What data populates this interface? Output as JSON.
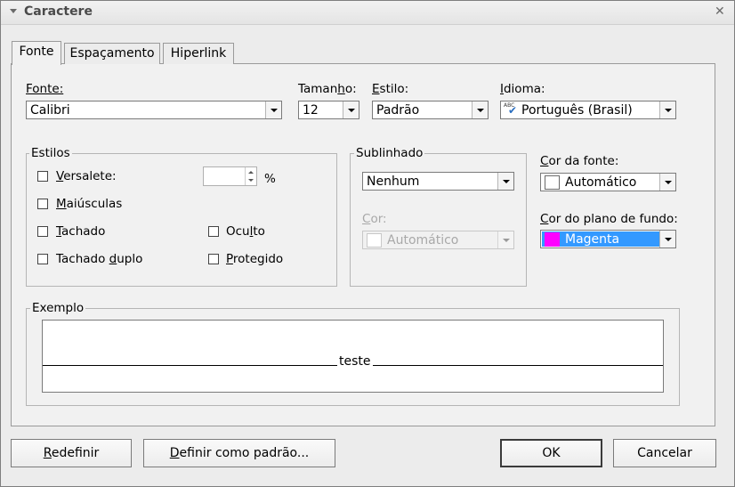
{
  "window": {
    "title": "Caractere"
  },
  "tabs": [
    {
      "label": "Fonte",
      "active": true
    },
    {
      "label": "Espaçamento",
      "active": false
    },
    {
      "label": "Hiperlink",
      "active": false
    }
  ],
  "font": {
    "label": "Fonte:",
    "value": "Calibri",
    "size_label_pre": "Taman",
    "size_label_key": "h",
    "size_label_post": "o:",
    "size_value": "12",
    "style_label_key": "E",
    "style_label_post": "stilo:",
    "style_value": "Padrão",
    "lang_label_key": "I",
    "lang_label_post": "dioma:",
    "lang_value": "Português (Brasil)",
    "lang_icon_text": "ABC"
  },
  "estilos": {
    "legend": "Estilos",
    "versalete_key": "V",
    "versalete_post": "ersalete:",
    "versalete_value": "",
    "percent": "%",
    "maiusculas_key": "M",
    "maiusculas_post": "aiúsculas",
    "tachado_key": "T",
    "tachado_post": "achado",
    "tachado_duplo_pre": "Tachado ",
    "tachado_duplo_key": "d",
    "tachado_duplo_post": "uplo",
    "oculto_pre": "Ocu",
    "oculto_key": "l",
    "oculto_post": "to",
    "protegido_key": "P",
    "protegido_post": "rotegido"
  },
  "sublinhado": {
    "legend": "Sublinhado",
    "value": "Nenhum",
    "cor_key": "C",
    "cor_post": "or:",
    "cor_value": "Automático"
  },
  "cor_fonte": {
    "label_key": "C",
    "label_post": "or da fonte:",
    "value": "Automático",
    "swatch": "#ffffff"
  },
  "cor_fundo": {
    "label_key": "C",
    "label_post": "or do plano de fundo:",
    "value": "Magenta",
    "swatch": "#ff00ff",
    "selected_bg": "#3399ff"
  },
  "exemplo": {
    "legend": "Exemplo",
    "text": "teste"
  },
  "buttons": {
    "redefinir_key": "R",
    "redefinir_post": "edefinir",
    "padrao_key": "D",
    "padrao_post": "efinir como padrão...",
    "ok": "OK",
    "cancelar": "Cancelar"
  }
}
